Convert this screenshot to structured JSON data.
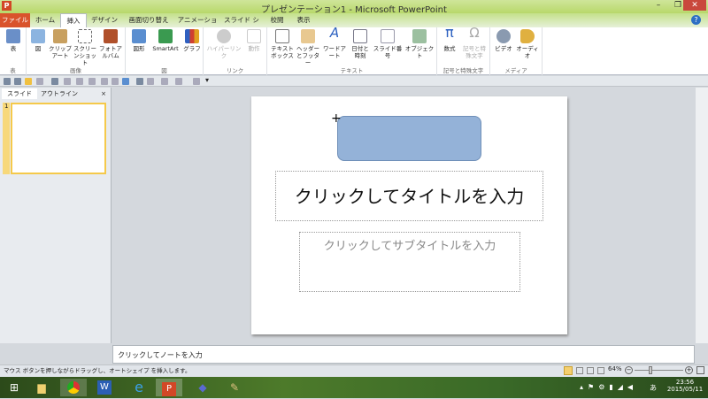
{
  "window": {
    "title": "プレゼンテーション1 - Microsoft PowerPoint",
    "app_icon": "P",
    "minimize": "–",
    "restore": "❐",
    "close": "✕"
  },
  "tabs": [
    "ファイル",
    "ホーム",
    "挿入",
    "デザイン",
    "画面切り替え",
    "アニメーション",
    "スライド ショー",
    "校閲",
    "表示"
  ],
  "ribbon": {
    "groups": [
      "表",
      "画像",
      "図",
      "リンク",
      "テキスト",
      "記号と特殊文字",
      "メディア"
    ],
    "buttons": {
      "table": "表",
      "picture": "図",
      "clipart": "クリップアート",
      "screenshot": "スクリーンショット",
      "album": "フォトアルバム",
      "shapes": "図形",
      "smartart": "SmartArt",
      "chart": "グラフ",
      "hyperlink": "ハイパーリンク",
      "action": "動作",
      "textbox": "テキストボックス",
      "header": "ヘッダーとフッター",
      "wordart": "ワードアート",
      "datetime": "日付と時刻",
      "slidenum": "スライド番号",
      "object": "オブジェクト",
      "equation": "数式",
      "symbol": "記号と特殊文字",
      "video": "ビデオ",
      "audio": "オーディオ"
    }
  },
  "left_panel": {
    "tab_slides": "スライド",
    "tab_outline": "アウトライン",
    "close": "×",
    "slide_number": "1"
  },
  "slide": {
    "title_placeholder": "クリックしてタイトルを入力",
    "subtitle_placeholder": "クリックしてサブタイトルを入力"
  },
  "notes": {
    "placeholder": "クリックしてノートを入力"
  },
  "status": {
    "message": "マウス ボタンを押しながらドラッグし、オートシェイプ を挿入します。",
    "zoom": "64%",
    "zoom_level": 0.64
  },
  "taskbar": {
    "time": "23:56",
    "date": "2015/05/11",
    "ime": "あ"
  },
  "colors": {
    "shape_fill": "#94b2d8",
    "file_tab": "#d9532c",
    "title_bar": "#c4e08a"
  }
}
